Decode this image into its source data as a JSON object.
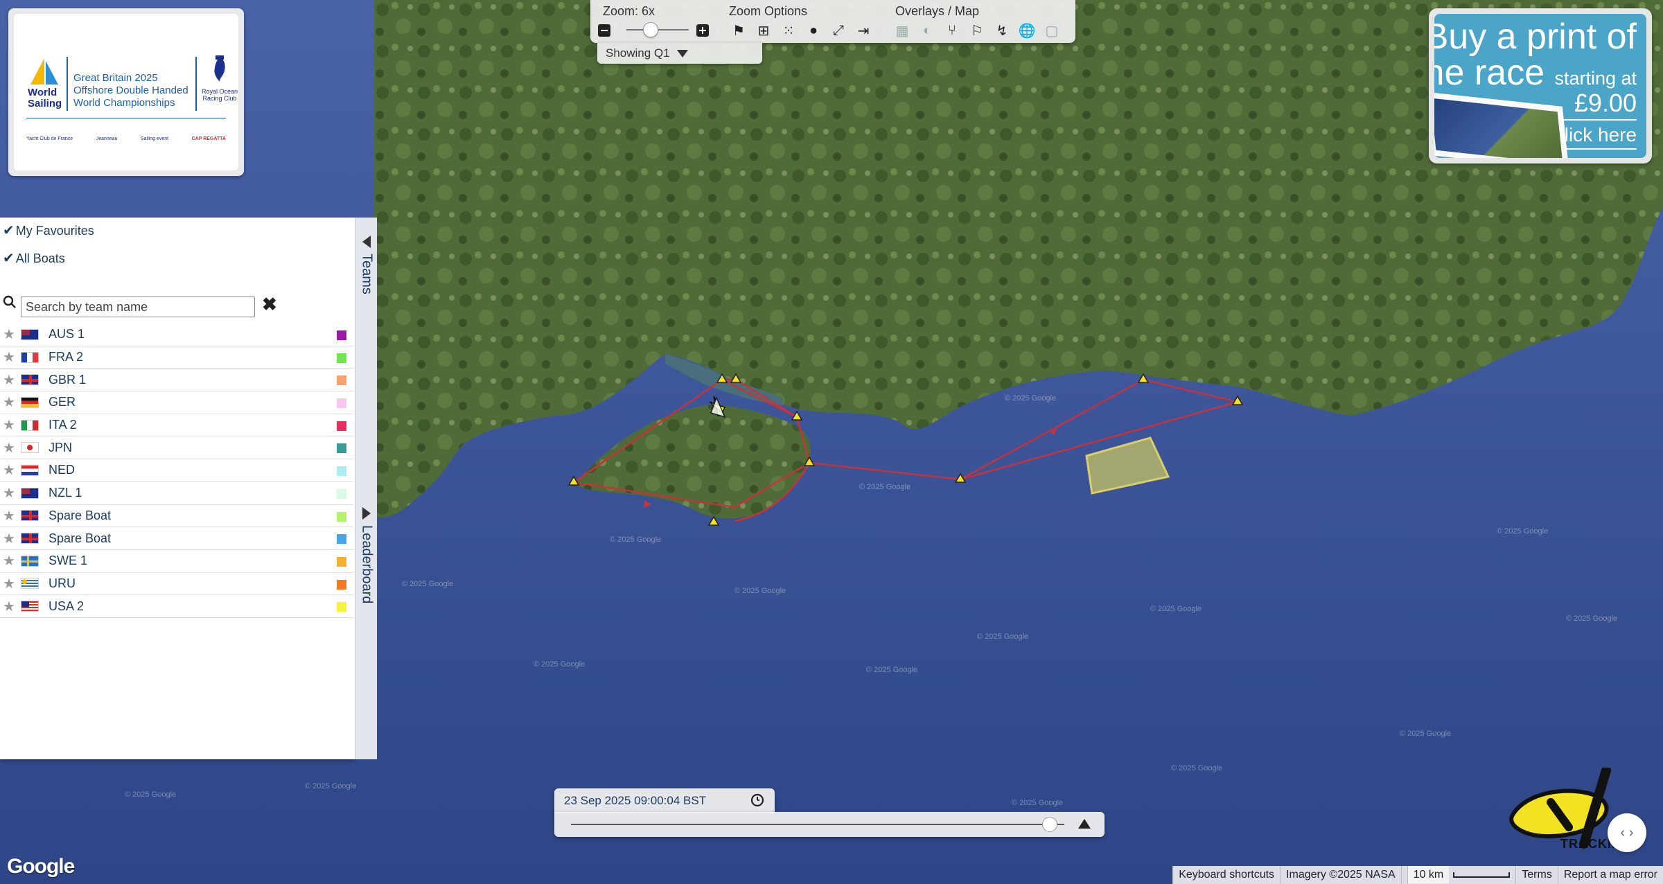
{
  "logo": {
    "ws_line1": "World",
    "ws_line2": "Sailing",
    "event_line1": "Great Britain 2025",
    "event_line2": "Offshore Double Handed",
    "event_line3": "World Championships",
    "rorc_line1": "Royal Ocean",
    "rorc_line2": "Racing Club",
    "sponsor1": "Yacht Club de France",
    "sponsor2": "Jeanneau",
    "sponsor3": "Sailing event",
    "sponsor4": "CAP REGATTA"
  },
  "toolbar": {
    "zoom_label": "Zoom: 6x",
    "zoom_options_label": "Zoom Options",
    "overlays_label": "Overlays / Map",
    "showing": "Showing Q1"
  },
  "ad": {
    "line1": "Buy a print of",
    "line2": "the race",
    "line2_small": "starting at",
    "price": "£9.00",
    "cta": "click here"
  },
  "sidebar": {
    "my_favourites": "My Favourites",
    "all_boats": "All Boats",
    "search_placeholder": "Search by team name",
    "tab_teams": "Teams",
    "tab_leaderboard": "Leaderboard",
    "boats": [
      {
        "name": "AUS 1",
        "flag": "AU",
        "color": "#9c1aa8"
      },
      {
        "name": "FRA 2",
        "flag": "FR",
        "color": "#6ee84a"
      },
      {
        "name": "GBR 1",
        "flag": "GB",
        "color": "#f5a26e"
      },
      {
        "name": "GER",
        "flag": "DE",
        "color": "#f7c7f2"
      },
      {
        "name": "ITA 2",
        "flag": "IT",
        "color": "#e8305e"
      },
      {
        "name": "JPN",
        "flag": "JP",
        "color": "#3a9a98"
      },
      {
        "name": "NED",
        "flag": "NL",
        "color": "#aeeef2"
      },
      {
        "name": "NZL 1",
        "flag": "NZ",
        "color": "#dafbe8"
      },
      {
        "name": "Spare Boat",
        "flag": "GB",
        "color": "#b5f26a"
      },
      {
        "name": "Spare Boat",
        "flag": "GB",
        "color": "#4aa5e8"
      },
      {
        "name": "SWE 1",
        "flag": "SE",
        "color": "#f5b02e"
      },
      {
        "name": "URU",
        "flag": "UY",
        "color": "#f27a22"
      },
      {
        "name": "USA 2",
        "flag": "US",
        "color": "#f7f23a"
      }
    ]
  },
  "timeline": {
    "datetime": "23 Sep 2025 09:00:04 BST",
    "position_fraction": 0.97
  },
  "map": {
    "google": "Google",
    "yb_text": "TRACKING",
    "copyright": "© 2025 Google"
  },
  "footer": {
    "shortcuts": "Keyboard shortcuts",
    "imagery": "Imagery ©2025 NASA",
    "scale": "10 km",
    "terms": "Terms",
    "report": "Report a map error"
  }
}
